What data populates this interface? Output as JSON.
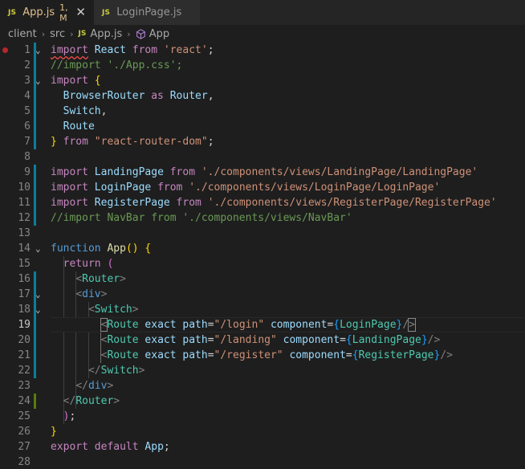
{
  "tabs": [
    {
      "badge": "JS",
      "title": "App.js",
      "status": "1, M",
      "close": "✕",
      "active": true
    },
    {
      "badge": "JS",
      "title": "LoginPage.js",
      "active": false
    }
  ],
  "breadcrumb": {
    "items": [
      "client",
      "src"
    ],
    "file_badge": "JS",
    "file": "App.js",
    "symbol": "App"
  },
  "editor": {
    "current_line": 19,
    "lines": [
      {
        "n": "1",
        "t": [
          [
            "import",
            "ctl squiggle"
          ],
          [
            " "
          ],
          [
            "React",
            "var"
          ],
          [
            " "
          ],
          [
            "from",
            "ctl"
          ],
          [
            " "
          ],
          [
            "'react'",
            "str"
          ],
          [
            ";"
          ]
        ]
      },
      {
        "n": "2",
        "t": [
          [
            "//import './App.css';",
            "cmt"
          ]
        ]
      },
      {
        "n": "3",
        "t": [
          [
            "import",
            "ctl"
          ],
          [
            " "
          ],
          [
            "{",
            "br1"
          ]
        ]
      },
      {
        "n": "4",
        "t": [
          [
            "  "
          ],
          [
            "BrowserRouter",
            "var"
          ],
          [
            " "
          ],
          [
            "as",
            "ctl"
          ],
          [
            " "
          ],
          [
            "Router",
            "var"
          ],
          [
            ","
          ]
        ]
      },
      {
        "n": "5",
        "t": [
          [
            "  "
          ],
          [
            "Switch",
            "var"
          ],
          [
            ","
          ]
        ]
      },
      {
        "n": "6",
        "t": [
          [
            "  "
          ],
          [
            "Route",
            "var"
          ]
        ]
      },
      {
        "n": "7",
        "t": [
          [
            "}",
            "br1"
          ],
          [
            " "
          ],
          [
            "from",
            "ctl"
          ],
          [
            " "
          ],
          [
            "\"react-router-dom\"",
            "str"
          ],
          [
            ";"
          ]
        ]
      },
      {
        "n": "8",
        "t": []
      },
      {
        "n": "9",
        "t": [
          [
            "import",
            "ctl"
          ],
          [
            " "
          ],
          [
            "LandingPage",
            "var"
          ],
          [
            " "
          ],
          [
            "from",
            "ctl"
          ],
          [
            " "
          ],
          [
            "'./components/views/LandingPage/LandingPage'",
            "str"
          ]
        ]
      },
      {
        "n": "10",
        "t": [
          [
            "import",
            "ctl"
          ],
          [
            " "
          ],
          [
            "LoginPage",
            "var"
          ],
          [
            " "
          ],
          [
            "from",
            "ctl"
          ],
          [
            " "
          ],
          [
            "'./components/views/LoginPage/LoginPage'",
            "str"
          ]
        ]
      },
      {
        "n": "11",
        "t": [
          [
            "import",
            "ctl"
          ],
          [
            " "
          ],
          [
            "RegisterPage",
            "var"
          ],
          [
            " "
          ],
          [
            "from",
            "ctl"
          ],
          [
            " "
          ],
          [
            "'./components/views/RegisterPage/RegisterPage'",
            "str"
          ]
        ]
      },
      {
        "n": "12",
        "t": [
          [
            "//import NavBar from './components/views/NavBar'",
            "cmt"
          ]
        ]
      },
      {
        "n": "13",
        "t": []
      },
      {
        "n": "14",
        "t": [
          [
            "function",
            "kw"
          ],
          [
            " "
          ],
          [
            "App",
            "fn"
          ],
          [
            "(",
            "br1"
          ],
          [
            ")",
            "br1"
          ],
          [
            " "
          ],
          [
            "{",
            "br1"
          ]
        ]
      },
      {
        "n": "15",
        "t": [
          [
            "  "
          ],
          [
            "return",
            "ctl"
          ],
          [
            " "
          ],
          [
            "(",
            "br2"
          ]
        ]
      },
      {
        "n": "16",
        "t": [
          [
            "    "
          ],
          [
            "<",
            "tag"
          ],
          [
            "Router",
            "cls"
          ],
          [
            ">",
            "tag"
          ]
        ]
      },
      {
        "n": "17",
        "t": [
          [
            "    "
          ],
          [
            "<",
            "tag"
          ],
          [
            "div",
            "kw"
          ],
          [
            ">",
            "tag"
          ]
        ]
      },
      {
        "n": "18",
        "t": [
          [
            "      "
          ],
          [
            "<",
            "tag"
          ],
          [
            "Switch",
            "cls"
          ],
          [
            ">",
            "tag"
          ]
        ]
      },
      {
        "n": "19",
        "t": [
          [
            "        "
          ],
          [
            "<",
            "tag cursor-bracket"
          ],
          [
            "Route",
            "cls"
          ],
          [
            " "
          ],
          [
            "exact",
            "var"
          ],
          [
            " "
          ],
          [
            "path",
            "var"
          ],
          [
            "="
          ],
          [
            "\"/login\"",
            "str"
          ],
          [
            " "
          ],
          [
            "component",
            "var"
          ],
          [
            "="
          ],
          [
            "{",
            "br3"
          ],
          [
            "LoginPage",
            "cls"
          ],
          [
            "}",
            "br3"
          ],
          [
            "/",
            "tag"
          ],
          [
            ">",
            "tag cursor-bracket"
          ]
        ]
      },
      {
        "n": "20",
        "t": [
          [
            "        "
          ],
          [
            "<",
            "tag"
          ],
          [
            "Route",
            "cls"
          ],
          [
            " "
          ],
          [
            "exact",
            "var"
          ],
          [
            " "
          ],
          [
            "path",
            "var"
          ],
          [
            "="
          ],
          [
            "\"/landing\"",
            "str"
          ],
          [
            " "
          ],
          [
            "component",
            "var"
          ],
          [
            "="
          ],
          [
            "{",
            "br3"
          ],
          [
            "LandingPage",
            "cls"
          ],
          [
            "}",
            "br3"
          ],
          [
            "/>",
            "tag"
          ]
        ]
      },
      {
        "n": "21",
        "t": [
          [
            "        "
          ],
          [
            "<",
            "tag"
          ],
          [
            "Route",
            "cls"
          ],
          [
            " "
          ],
          [
            "exact",
            "var"
          ],
          [
            " "
          ],
          [
            "path",
            "var"
          ],
          [
            "="
          ],
          [
            "\"/register\"",
            "str"
          ],
          [
            " "
          ],
          [
            "component",
            "var"
          ],
          [
            "="
          ],
          [
            "{",
            "br3"
          ],
          [
            "RegisterPage",
            "cls"
          ],
          [
            "}",
            "br3"
          ],
          [
            "/>",
            "tag"
          ]
        ]
      },
      {
        "n": "22",
        "t": [
          [
            "      "
          ],
          [
            "</",
            "tag"
          ],
          [
            "Switch",
            "cls"
          ],
          [
            ">",
            "tag"
          ]
        ]
      },
      {
        "n": "23",
        "t": [
          [
            "    "
          ],
          [
            "</",
            "tag"
          ],
          [
            "div",
            "kw"
          ],
          [
            ">",
            "tag"
          ]
        ]
      },
      {
        "n": "24",
        "t": [
          [
            "  "
          ],
          [
            "</",
            "tag"
          ],
          [
            "Router",
            "cls"
          ],
          [
            ">",
            "tag"
          ]
        ]
      },
      {
        "n": "25",
        "t": [
          [
            "  "
          ],
          [
            ")",
            "br2"
          ],
          [
            ";"
          ]
        ]
      },
      {
        "n": "26",
        "t": [
          [
            "}",
            "br1"
          ]
        ]
      },
      {
        "n": "27",
        "t": [
          [
            "export",
            "ctl"
          ],
          [
            " "
          ],
          [
            "default",
            "ctl"
          ],
          [
            " "
          ],
          [
            "App",
            "var"
          ],
          [
            ";"
          ]
        ]
      },
      {
        "n": "28",
        "t": []
      }
    ],
    "fold_lines": [
      "1",
      "3",
      "14",
      "17",
      "18"
    ],
    "fold_glyph": "⌄",
    "modified_lines": [
      "1",
      "2",
      "3",
      "4",
      "5",
      "6",
      "7",
      "9",
      "10",
      "11",
      "12",
      "16",
      "17",
      "18",
      "19",
      "20",
      "21",
      "22"
    ],
    "added_lines": [
      "24"
    ],
    "breakpoint_line": "1"
  },
  "colors": {
    "background": "#1e1e1e",
    "tab_inactive": "#2d2d2d",
    "keyword": "#569cd6",
    "control": "#c586c0",
    "variable": "#9cdcfe",
    "component": "#4ec9b0",
    "function": "#dcdcaa",
    "string": "#ce9178",
    "comment": "#6a9955",
    "git_modified": "#0c7d9d",
    "git_added": "#587c0c"
  }
}
